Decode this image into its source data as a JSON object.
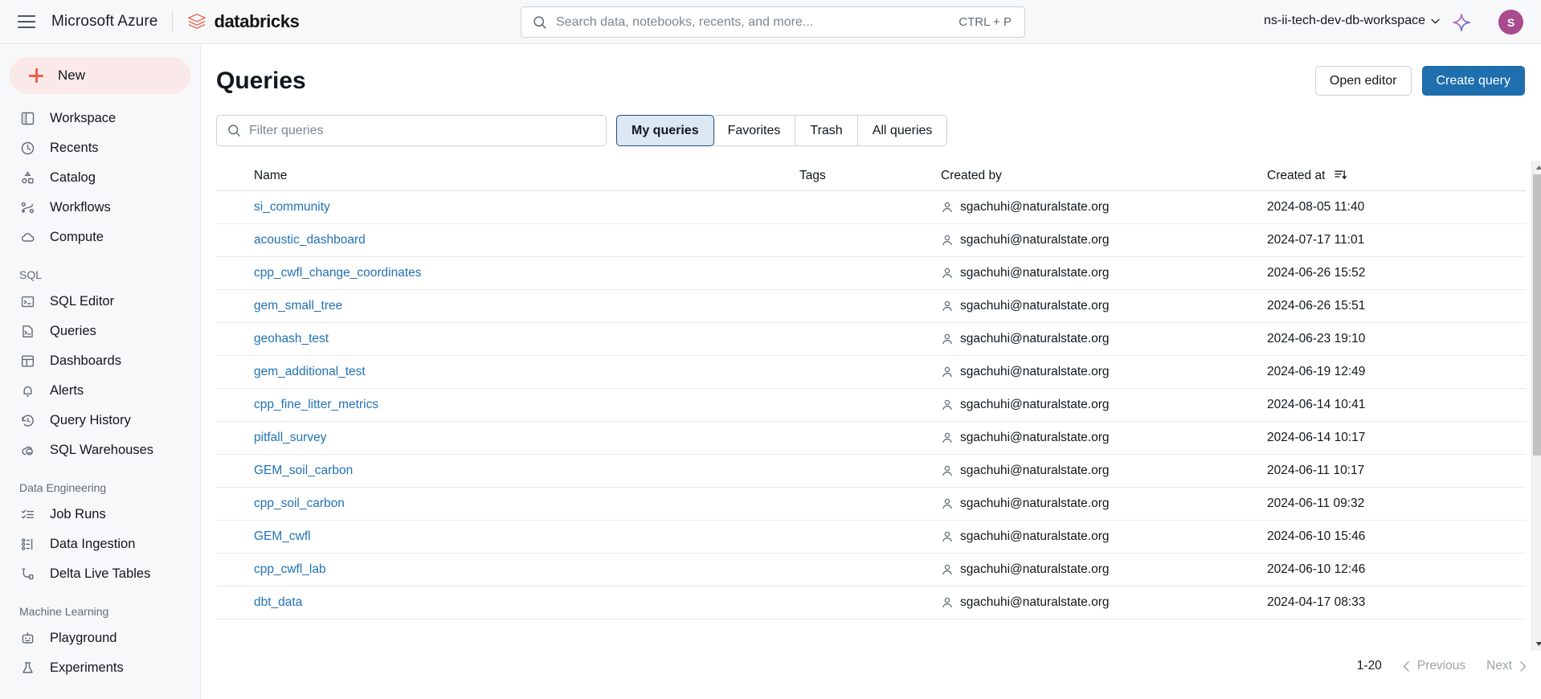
{
  "topbar": {
    "menu_icon": "hamburger-icon",
    "cloud_title": "Microsoft Azure",
    "product_name": "databricks",
    "search": {
      "placeholder": "Search data, notebooks, recents, and more...",
      "value": "",
      "shortcut": "CTRL + P",
      "icon": "search-icon"
    },
    "workspace": "ns-ii-tech-dev-db-workspace",
    "workspace_chevron": "chevron-down-icon",
    "assistant_icon": "sparkle-icon",
    "avatar_initial": "S",
    "avatar_color": "#a94b8e"
  },
  "sidebar": {
    "new_button": {
      "label": "New",
      "icon": "plus-icon",
      "bg": "#fae9e8",
      "accent": "#ef5c4c"
    },
    "items": [
      {
        "label": "Workspace",
        "icon": "workspace-icon"
      },
      {
        "label": "Recents",
        "icon": "clock-icon"
      },
      {
        "label": "Catalog",
        "icon": "catalog-icon"
      },
      {
        "label": "Workflows",
        "icon": "workflows-icon"
      },
      {
        "label": "Compute",
        "icon": "cloud-icon"
      }
    ],
    "sections": [
      {
        "title": "SQL",
        "items": [
          {
            "label": "SQL Editor",
            "icon": "sql-editor-icon"
          },
          {
            "label": "Queries",
            "icon": "queries-icon"
          },
          {
            "label": "Dashboards",
            "icon": "dashboards-icon"
          },
          {
            "label": "Alerts",
            "icon": "bell-icon"
          },
          {
            "label": "Query History",
            "icon": "history-icon"
          },
          {
            "label": "SQL Warehouses",
            "icon": "warehouse-icon"
          }
        ]
      },
      {
        "title": "Data Engineering",
        "items": [
          {
            "label": "Job Runs",
            "icon": "job-runs-icon"
          },
          {
            "label": "Data Ingestion",
            "icon": "data-ingestion-icon"
          },
          {
            "label": "Delta Live Tables",
            "icon": "delta-live-tables-icon"
          }
        ]
      },
      {
        "title": "Machine Learning",
        "items": [
          {
            "label": "Playground",
            "icon": "robot-icon"
          },
          {
            "label": "Experiments",
            "icon": "experiments-icon"
          }
        ]
      }
    ]
  },
  "main": {
    "title": "Queries",
    "open_editor_label": "Open editor",
    "create_query_label": "Create query",
    "filter": {
      "placeholder": "Filter queries",
      "value": "",
      "icon": "search-icon"
    },
    "tabs": [
      {
        "label": "My queries",
        "active": true
      },
      {
        "label": "Favorites",
        "active": false
      },
      {
        "label": "Trash",
        "active": false
      },
      {
        "label": "All queries",
        "active": false
      }
    ],
    "accent_color": "#1f6ead",
    "link_color": "#2272b4",
    "table": {
      "columns": [
        "Name",
        "Tags",
        "Created by",
        "Created at"
      ],
      "sort_column": "Created at",
      "sort_icon": "sort-descending-icon",
      "rows": [
        {
          "name": "si_community",
          "tags": "",
          "created_by": "sgachuhi@naturalstate.org",
          "created_at": "2024-08-05 11:40"
        },
        {
          "name": "acoustic_dashboard",
          "tags": "",
          "created_by": "sgachuhi@naturalstate.org",
          "created_at": "2024-07-17 11:01"
        },
        {
          "name": "cpp_cwfl_change_coordinates",
          "tags": "",
          "created_by": "sgachuhi@naturalstate.org",
          "created_at": "2024-06-26 15:52"
        },
        {
          "name": "gem_small_tree",
          "tags": "",
          "created_by": "sgachuhi@naturalstate.org",
          "created_at": "2024-06-26 15:51"
        },
        {
          "name": "geohash_test",
          "tags": "",
          "created_by": "sgachuhi@naturalstate.org",
          "created_at": "2024-06-23 19:10"
        },
        {
          "name": "gem_additional_test",
          "tags": "",
          "created_by": "sgachuhi@naturalstate.org",
          "created_at": "2024-06-19 12:49"
        },
        {
          "name": "cpp_fine_litter_metrics",
          "tags": "",
          "created_by": "sgachuhi@naturalstate.org",
          "created_at": "2024-06-14 10:41"
        },
        {
          "name": "pitfall_survey",
          "tags": "",
          "created_by": "sgachuhi@naturalstate.org",
          "created_at": "2024-06-14 10:17"
        },
        {
          "name": "GEM_soil_carbon",
          "tags": "",
          "created_by": "sgachuhi@naturalstate.org",
          "created_at": "2024-06-11 10:17"
        },
        {
          "name": "cpp_soil_carbon",
          "tags": "",
          "created_by": "sgachuhi@naturalstate.org",
          "created_at": "2024-06-11 09:32"
        },
        {
          "name": "GEM_cwfl",
          "tags": "",
          "created_by": "sgachuhi@naturalstate.org",
          "created_at": "2024-06-10 15:46"
        },
        {
          "name": "cpp_cwfl_lab",
          "tags": "",
          "created_by": "sgachuhi@naturalstate.org",
          "created_at": "2024-06-10 12:46"
        },
        {
          "name": "dbt_data",
          "tags": "",
          "created_by": "sgachuhi@naturalstate.org",
          "created_at": "2024-04-17 08:33"
        }
      ]
    },
    "pagination": {
      "range": "1-20",
      "previous_label": "Previous",
      "next_label": "Next"
    }
  }
}
